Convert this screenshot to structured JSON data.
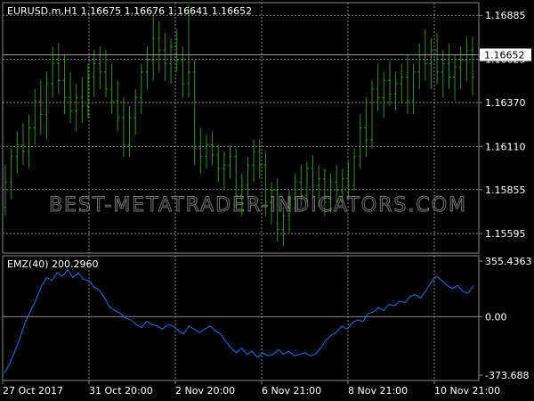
{
  "window": {
    "symbol_title": "EURUSD.m,H1  1.16675 1.16676 1.16641 1.16652",
    "watermark": "BEST-METATRADER-INDICATORS.COM"
  },
  "colors": {
    "background": "#000000",
    "grid": "#8a8a8a",
    "price_bars": "#3a8a2e",
    "indicator_line": "#2f6fe0",
    "text": "#ffffff",
    "current_price_box_bg": "#ffffff",
    "current_price_box_text": "#000000"
  },
  "chart_data": [
    {
      "type": "bar",
      "subtype": "ohlc",
      "title": "EURUSD.m,H1  1.16675 1.16676 1.16641 1.16652",
      "y_ticks": [
        "1.16885",
        "1.16625",
        "1.16370",
        "1.16110",
        "1.15855",
        "1.15595"
      ],
      "ylim": [
        1.1548,
        1.1696
      ],
      "current_price": "1.16652",
      "current_price_value": 1.16652,
      "x_ticks": [
        "27 Oct 2017",
        "31 Oct 20:00",
        "2 Nov 20:00",
        "6 Nov 21:00",
        "8 Nov 21:00",
        "10 Nov 21:00"
      ],
      "series": [
        {
          "values": [
            [
              1.1575,
              1.16,
              1.157,
              1.159
            ],
            [
              1.159,
              1.161,
              1.158,
              1.1605
            ],
            [
              1.1605,
              1.162,
              1.1595,
              1.1612
            ],
            [
              1.1612,
              1.1625,
              1.16,
              1.1608
            ],
            [
              1.1608,
              1.163,
              1.1598,
              1.1622
            ],
            [
              1.1622,
              1.1645,
              1.1612,
              1.1638
            ],
            [
              1.1638,
              1.165,
              1.1618,
              1.163
            ],
            [
              1.163,
              1.1655,
              1.1615,
              1.1648
            ],
            [
              1.1648,
              1.167,
              1.164,
              1.166
            ],
            [
              1.166,
              1.1672,
              1.1642,
              1.165
            ],
            [
              1.165,
              1.1665,
              1.163,
              1.164
            ],
            [
              1.164,
              1.1655,
              1.1625,
              1.1632
            ],
            [
              1.1632,
              1.1648,
              1.162,
              1.164
            ],
            [
              1.164,
              1.1652,
              1.1625,
              1.1635
            ],
            [
              1.1635,
              1.166,
              1.1628,
              1.1652
            ],
            [
              1.1652,
              1.1668,
              1.164,
              1.166
            ],
            [
              1.166,
              1.167,
              1.1645,
              1.1655
            ],
            [
              1.1655,
              1.1668,
              1.164,
              1.1645
            ],
            [
              1.1645,
              1.166,
              1.163,
              1.1638
            ],
            [
              1.1638,
              1.165,
              1.162,
              1.1628
            ],
            [
              1.1628,
              1.164,
              1.1605,
              1.1612
            ],
            [
              1.1612,
              1.1635,
              1.1605,
              1.1628
            ],
            [
              1.1628,
              1.1645,
              1.1618,
              1.164
            ],
            [
              1.164,
              1.166,
              1.163,
              1.1655
            ],
            [
              1.1655,
              1.167,
              1.1645,
              1.1662
            ],
            [
              1.1662,
              1.169,
              1.165,
              1.1675
            ],
            [
              1.1675,
              1.1685,
              1.1655,
              1.1668
            ],
            [
              1.1668,
              1.1678,
              1.165,
              1.166
            ],
            [
              1.166,
              1.1675,
              1.1648,
              1.167
            ],
            [
              1.167,
              1.168,
              1.1655,
              1.1662
            ],
            [
              1.1662,
              1.167,
              1.164,
              1.1648
            ],
            [
              1.1648,
              1.1695,
              1.164,
              1.1655
            ],
            [
              1.1655,
              1.1662,
              1.16,
              1.161
            ],
            [
              1.161,
              1.1622,
              1.1595,
              1.1605
            ],
            [
              1.1605,
              1.1618,
              1.1598,
              1.1612
            ],
            [
              1.1612,
              1.162,
              1.16,
              1.1606
            ],
            [
              1.1606,
              1.1612,
              1.159,
              1.1598
            ],
            [
              1.1598,
              1.1608,
              1.1585,
              1.16
            ],
            [
              1.16,
              1.1612,
              1.1592,
              1.1605
            ],
            [
              1.1605,
              1.161,
              1.1575,
              1.1582
            ],
            [
              1.1582,
              1.1595,
              1.157,
              1.1588
            ],
            [
              1.1588,
              1.1605,
              1.158,
              1.16
            ],
            [
              1.16,
              1.1615,
              1.159,
              1.1608
            ],
            [
              1.1608,
              1.1615,
              1.1592,
              1.16
            ],
            [
              1.16,
              1.1608,
              1.157,
              1.1578
            ],
            [
              1.1578,
              1.159,
              1.1565,
              1.1585
            ],
            [
              1.1585,
              1.1592,
              1.1555,
              1.1562
            ],
            [
              1.1562,
              1.1575,
              1.1552,
              1.157
            ],
            [
              1.157,
              1.1585,
              1.156,
              1.158
            ],
            [
              1.158,
              1.1595,
              1.1572,
              1.159
            ],
            [
              1.159,
              1.16,
              1.1575,
              1.1582
            ],
            [
              1.1582,
              1.1602,
              1.1578,
              1.1598
            ],
            [
              1.1598,
              1.1606,
              1.158,
              1.1588
            ],
            [
              1.1588,
              1.16,
              1.1575,
              1.1592
            ],
            [
              1.1592,
              1.1598,
              1.157,
              1.1578
            ],
            [
              1.1578,
              1.1595,
              1.1572,
              1.159
            ],
            [
              1.159,
              1.16,
              1.1578,
              1.1585
            ],
            [
              1.1585,
              1.1598,
              1.1578,
              1.1592
            ],
            [
              1.1592,
              1.1602,
              1.158,
              1.1588
            ],
            [
              1.1588,
              1.161,
              1.1585,
              1.1605
            ],
            [
              1.1605,
              1.163,
              1.1598,
              1.1622
            ],
            [
              1.1622,
              1.164,
              1.1605,
              1.1615
            ],
            [
              1.1615,
              1.165,
              1.161,
              1.1645
            ],
            [
              1.1645,
              1.166,
              1.1632,
              1.164
            ],
            [
              1.164,
              1.1655,
              1.1628,
              1.165
            ],
            [
              1.165,
              1.1662,
              1.1635,
              1.1642
            ],
            [
              1.1642,
              1.1655,
              1.1632,
              1.1648
            ],
            [
              1.1648,
              1.166,
              1.1636,
              1.1652
            ],
            [
              1.1652,
              1.1665,
              1.163,
              1.1638
            ],
            [
              1.1638,
              1.166,
              1.163,
              1.1655
            ],
            [
              1.1655,
              1.1672,
              1.1645,
              1.1665
            ],
            [
              1.1665,
              1.168,
              1.165,
              1.166
            ],
            [
              1.166,
              1.1675,
              1.1645,
              1.1668
            ],
            [
              1.1668,
              1.1678,
              1.1648,
              1.1655
            ],
            [
              1.1655,
              1.1668,
              1.164,
              1.166
            ],
            [
              1.166,
              1.1672,
              1.1645,
              1.1652
            ],
            [
              1.1652,
              1.1665,
              1.1638,
              1.1658
            ],
            [
              1.1658,
              1.167,
              1.1645,
              1.1662
            ],
            [
              1.1662,
              1.1676,
              1.165,
              1.1668
            ],
            [
              1.1668,
              1.1676,
              1.1641,
              1.1652
            ]
          ]
        }
      ]
    },
    {
      "type": "line",
      "title": "EMZ(40) 200.2960",
      "y_ticks": [
        "355.4363",
        "0.00",
        "-373.688"
      ],
      "ylim": [
        -373.688,
        355.4363
      ],
      "series": [
        {
          "values": [
            -360,
            -300,
            -220,
            -130,
            -30,
            40,
            110,
            190,
            250,
            230,
            280,
            260,
            300,
            250,
            280,
            240,
            230,
            190,
            170,
            120,
            60,
            40,
            20,
            -10,
            -20,
            -50,
            -70,
            -30,
            -50,
            -60,
            -80,
            -50,
            -60,
            -90,
            -110,
            -60,
            -80,
            -100,
            -80,
            -60,
            -90,
            -110,
            -160,
            -200,
            -230,
            -200,
            -240,
            -220,
            -260,
            -230,
            -250,
            -240,
            -210,
            -240,
            -220,
            -250,
            -240,
            -230,
            -250,
            -240,
            -200,
            -150,
            -120,
            -100,
            -60,
            -80,
            -40,
            -20,
            -30,
            20,
            30,
            60,
            40,
            80,
            70,
            100,
            90,
            130,
            140,
            120,
            170,
            220,
            260,
            230,
            200,
            180,
            200,
            160,
            150,
            200
          ]
        }
      ]
    }
  ]
}
